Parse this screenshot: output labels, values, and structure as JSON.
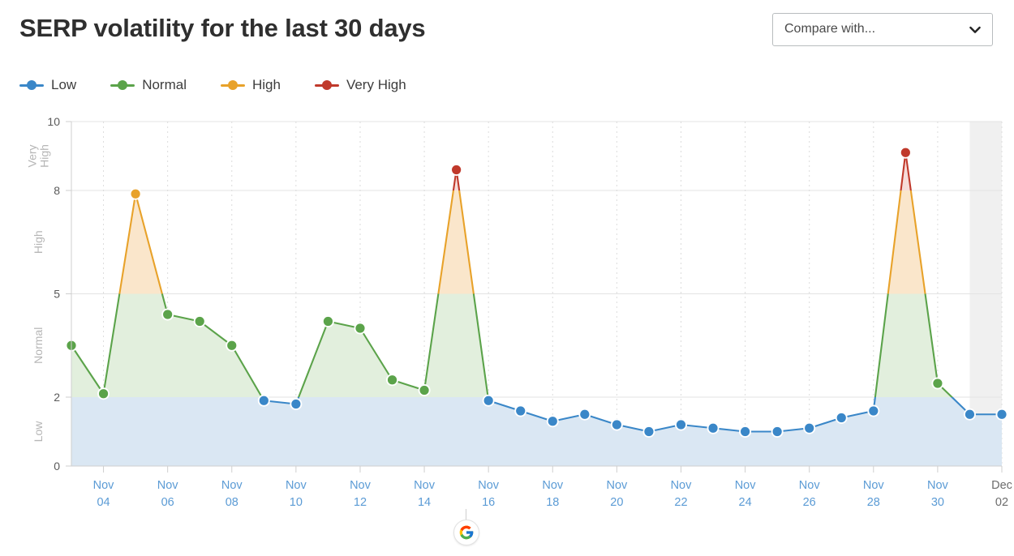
{
  "header": {
    "title": "SERP volatility for the last 30 days",
    "compare_label": "Compare with...",
    "chevron_icon": "chevron-down-icon"
  },
  "legend": {
    "items": [
      {
        "label": "Low",
        "color": "#3a87c8"
      },
      {
        "label": "Normal",
        "color": "#5ba34a"
      },
      {
        "label": "High",
        "color": "#e8a22a"
      },
      {
        "label": "Very High",
        "color": "#c0392b"
      }
    ]
  },
  "footer": {
    "engine_icon": "google-icon"
  },
  "chart_data": {
    "type": "area",
    "title": "SERP volatility for the last 30 days",
    "xlabel": "",
    "ylabel": "",
    "ylim": [
      0,
      10
    ],
    "yticks": [
      0,
      2,
      5,
      8,
      10
    ],
    "ytick_labels": [
      "0",
      "2",
      "5",
      "8",
      "10"
    ],
    "bands": [
      {
        "label": "Low",
        "from": 0,
        "to": 2,
        "color": "#dae7f3",
        "line": "#3a87c8"
      },
      {
        "label": "Normal",
        "from": 2,
        "to": 5,
        "color": "#e2efdd",
        "line": "#5ba34a"
      },
      {
        "label": "High",
        "from": 5,
        "to": 8,
        "color": "#fae6cb",
        "line": "#e8a22a"
      },
      {
        "label": "Very High",
        "from": 8,
        "to": 10,
        "color": "#f6dcd9",
        "line": "#c0392b"
      }
    ],
    "grid": true,
    "legend_position": "top-left",
    "forecast_shading": {
      "from_x": "Dec 01",
      "color": "#ebebeb"
    },
    "x": [
      "Nov 03",
      "Nov 04",
      "Nov 05",
      "Nov 06",
      "Nov 07",
      "Nov 08",
      "Nov 09",
      "Nov 10",
      "Nov 11",
      "Nov 12",
      "Nov 13",
      "Nov 14",
      "Nov 15",
      "Nov 16",
      "Nov 17",
      "Nov 18",
      "Nov 19",
      "Nov 20",
      "Nov 21",
      "Nov 22",
      "Nov 23",
      "Nov 24",
      "Nov 25",
      "Nov 26",
      "Nov 27",
      "Nov 28",
      "Nov 29",
      "Nov 30",
      "Dec 01",
      "Dec 02"
    ],
    "xtick_labels": [
      "Nov\n04",
      "Nov\n06",
      "Nov\n08",
      "Nov\n10",
      "Nov\n12",
      "Nov\n14",
      "Nov\n16",
      "Nov\n18",
      "Nov\n20",
      "Nov\n22",
      "Nov\n24",
      "Nov\n26",
      "Nov\n28",
      "Nov\n30",
      "Dec\n02"
    ],
    "values": [
      3.5,
      2.1,
      7.9,
      4.4,
      4.2,
      3.5,
      1.9,
      1.8,
      4.2,
      4.0,
      2.5,
      2.2,
      8.6,
      1.9,
      1.6,
      1.3,
      1.5,
      1.2,
      1.0,
      1.2,
      1.1,
      1.0,
      1.0,
      1.1,
      1.4,
      1.6,
      9.1,
      2.4,
      1.5,
      1.5
    ],
    "point_levels": [
      "Normal",
      "Normal",
      "High",
      "Normal",
      "Normal",
      "Normal",
      "Low",
      "Low",
      "Normal",
      "Normal",
      "Normal",
      "Normal",
      "Very High",
      "Low",
      "Low",
      "Low",
      "Low",
      "Low",
      "Low",
      "Low",
      "Low",
      "Low",
      "Low",
      "Low",
      "Low",
      "Low",
      "Very High",
      "Normal",
      "Low",
      "Low"
    ]
  }
}
